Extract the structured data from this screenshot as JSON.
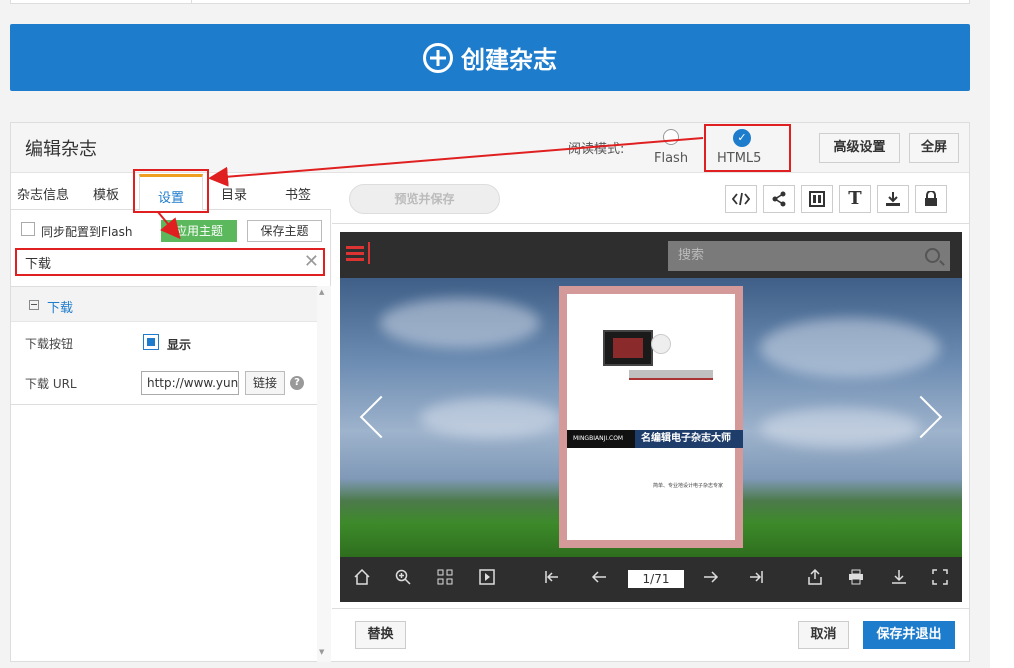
{
  "create_button": {
    "label": "创建杂志",
    "icon": "plus-circle-icon"
  },
  "panel": {
    "title": "编辑杂志",
    "read_mode_label": "阅读模式:",
    "modes": [
      {
        "label": "Flash",
        "selected": false
      },
      {
        "label": "HTML5",
        "selected": true
      }
    ],
    "advanced_button": "高级设置",
    "fullscreen_button": "全屏"
  },
  "tabs": [
    {
      "label": "杂志信息",
      "active": false
    },
    {
      "label": "模板",
      "active": false
    },
    {
      "label": "设置",
      "active": true
    },
    {
      "label": "目录",
      "active": false
    },
    {
      "label": "书签",
      "active": false
    }
  ],
  "options": {
    "sync_flash_label": "同步配置到Flash",
    "apply_theme": "应用主题",
    "save_theme": "保存主题"
  },
  "search": {
    "value": "下载",
    "clear_icon": "close-icon"
  },
  "section": {
    "title": "下载",
    "download_button_label": "下载按钮",
    "show_label": "显示",
    "show_checked": true,
    "download_url_label": "下载 URL",
    "download_url_value": "http://www.yun",
    "link_button": "链接",
    "help_icon": "?"
  },
  "toolbar": {
    "preview_save": "预览并保存",
    "text_icon_label": "T",
    "icons": [
      "code-icon",
      "share-icon",
      "layout-icon",
      "text-icon",
      "download-icon",
      "lock-icon"
    ]
  },
  "viewer": {
    "search_placeholder": "搜索",
    "book_banner_left": "MINGBIANJI.COM",
    "book_banner_right": "名编辑电子杂志大师",
    "book_subtext": "简单、专业地设计电子杂志专家",
    "page_indicator": "1/71",
    "controls": [
      "home-icon",
      "zoom-in-icon",
      "grid-icon",
      "autoplay-icon",
      "first-page-icon",
      "prev-page-icon",
      "next-page-icon",
      "last-page-icon",
      "share-icon",
      "print-icon",
      "download-icon",
      "fullscreen-icon"
    ]
  },
  "footer": {
    "replace": "替换",
    "cancel": "取消",
    "save_exit": "保存并退出"
  },
  "colors": {
    "primary": "#1e7ccd",
    "annotation": "#e02020",
    "apply_green": "#5cb85c",
    "tab_accent": "#f0a020"
  }
}
